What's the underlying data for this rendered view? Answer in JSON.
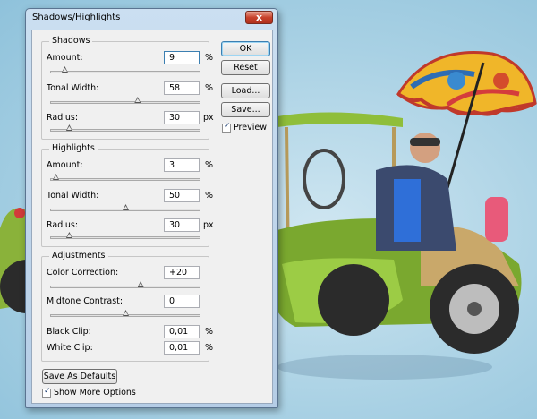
{
  "window": {
    "title": "Shadows/Highlights",
    "close_glyph": "x"
  },
  "shadows": {
    "group_label": "Shadows",
    "amount": {
      "label": "Amount:",
      "value": "9",
      "unit": "%",
      "slider_fraction": 0.09
    },
    "tonal_width": {
      "label": "Tonal Width:",
      "value": "58",
      "unit": "%",
      "slider_fraction": 0.58
    },
    "radius": {
      "label": "Radius:",
      "value": "30",
      "unit": "px",
      "slider_fraction": 0.12
    }
  },
  "highlights": {
    "group_label": "Highlights",
    "amount": {
      "label": "Amount:",
      "value": "3",
      "unit": "%",
      "slider_fraction": 0.03
    },
    "tonal_width": {
      "label": "Tonal Width:",
      "value": "50",
      "unit": "%",
      "slider_fraction": 0.5
    },
    "radius": {
      "label": "Radius:",
      "value": "30",
      "unit": "px",
      "slider_fraction": 0.12
    }
  },
  "adjustments": {
    "group_label": "Adjustments",
    "color_correction": {
      "label": "Color Correction:",
      "value": "+20",
      "slider_fraction": 0.6
    },
    "midtone_contrast": {
      "label": "Midtone Contrast:",
      "value": "0",
      "slider_fraction": 0.5
    },
    "black_clip": {
      "label": "Black Clip:",
      "value": "0,01",
      "unit": "%"
    },
    "white_clip": {
      "label": "White Clip:",
      "value": "0,01",
      "unit": "%"
    }
  },
  "buttons": {
    "ok": "OK",
    "reset": "Reset",
    "load": "Load...",
    "save": "Save...",
    "save_defaults": "Save As Defaults"
  },
  "preview": {
    "label": "Preview",
    "checked": true
  },
  "show_more": {
    "label": "Show More Options",
    "checked": true
  },
  "colors": {
    "dialog_bg": "#f0f0f0",
    "frame": "#b5cde6",
    "close_button": "#c8422c",
    "background": "#a9d1e4"
  }
}
